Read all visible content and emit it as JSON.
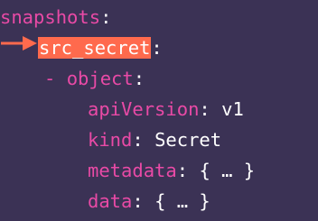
{
  "lines": {
    "l1": {
      "key": "snapshots",
      "colon": ":"
    },
    "l2": {
      "key": "src_secret",
      "colon": ":"
    },
    "l3": {
      "dash": "-",
      "key": "object",
      "colon": ":"
    },
    "l4": {
      "key": "apiVersion",
      "colon": ":",
      "value": "v1"
    },
    "l5": {
      "key": "kind",
      "colon": ":",
      "value": "Secret"
    },
    "l6": {
      "key": "metadata",
      "colon": ":",
      "value": "{ … }"
    },
    "l7": {
      "key": "data",
      "colon": ":",
      "value": "{ … }"
    }
  },
  "colors": {
    "background": "#3b3255",
    "key": "#e94aa6",
    "highlight": "#ff6a4d",
    "text": "#ffffff"
  },
  "icons": {
    "pointer": "arrow-right-icon"
  }
}
